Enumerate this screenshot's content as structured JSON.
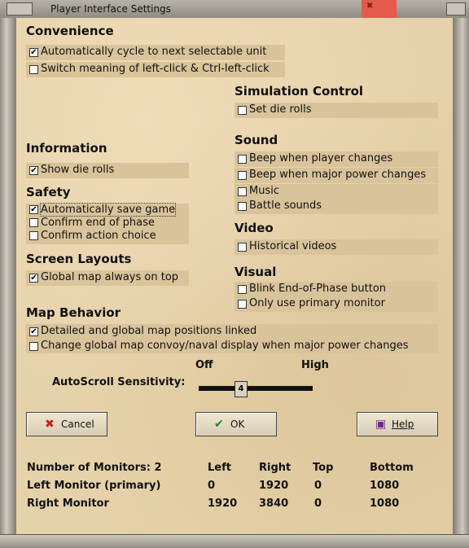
{
  "window": {
    "title": "Player Interface Settings"
  },
  "sections": {
    "convenience": {
      "title": "Convenience",
      "items": [
        {
          "label": "Automatically cycle to next selectable unit",
          "checked": true
        },
        {
          "label": "Switch meaning of left-click & Ctrl-left-click",
          "checked": false
        }
      ]
    },
    "simulation": {
      "title": "Simulation Control",
      "items": [
        {
          "label": "Set die rolls",
          "checked": false
        }
      ]
    },
    "information": {
      "title": "Information",
      "items": [
        {
          "label": "Show die rolls",
          "checked": true
        }
      ]
    },
    "sound": {
      "title": "Sound",
      "items": [
        {
          "label": "Beep when player changes",
          "checked": false
        },
        {
          "label": "Beep when major power changes",
          "checked": false
        },
        {
          "label": "Music",
          "checked": false
        },
        {
          "label": "Battle sounds",
          "checked": false
        }
      ]
    },
    "safety": {
      "title": "Safety",
      "items": [
        {
          "label": "Automatically save game",
          "checked": true
        },
        {
          "label": "Confirm end of phase",
          "checked": false
        },
        {
          "label": "Confirm action choice",
          "checked": false
        }
      ]
    },
    "video": {
      "title": "Video",
      "items": [
        {
          "label": "Historical videos",
          "checked": false
        }
      ]
    },
    "layouts": {
      "title": "Screen Layouts",
      "items": [
        {
          "label": "Global map always on top",
          "checked": true
        }
      ]
    },
    "visual": {
      "title": "Visual",
      "items": [
        {
          "label": "Blink End-of-Phase button",
          "checked": false
        },
        {
          "label": "Only use primary monitor",
          "checked": false
        }
      ]
    },
    "map": {
      "title": "Map Behavior",
      "items": [
        {
          "label": "Detailed and global map positions linked",
          "checked": true
        },
        {
          "label": "Change global map convoy/naval display when major power changes",
          "checked": false
        }
      ]
    }
  },
  "autoscroll": {
    "label": "AutoScroll Sensitivity:",
    "min_label": "Off",
    "max_label": "High",
    "value": "4"
  },
  "buttons": {
    "cancel": "Cancel",
    "ok": "OK",
    "help": "Help"
  },
  "monitors": {
    "headers": [
      "Number of Monitors: 2",
      "Left",
      "Right",
      "Top",
      "Bottom"
    ],
    "rows": [
      [
        "Left Monitor (primary)",
        "0",
        "1920",
        "0",
        "1080"
      ],
      [
        "Right Monitor",
        "1920",
        "3840",
        "0",
        "1080"
      ]
    ]
  }
}
